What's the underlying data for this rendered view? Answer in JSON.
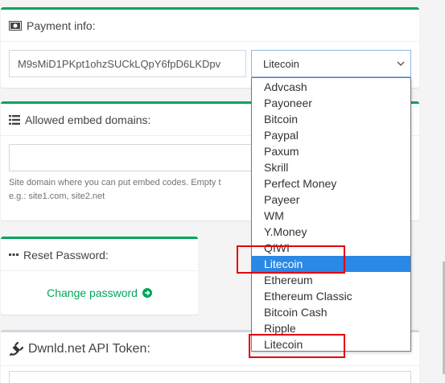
{
  "payment": {
    "title": "Payment info:",
    "address_value": "M9sMiD1PKpt1ohzSUCkLQpY6fpD6LKDpv",
    "method_selected": "Litecoin"
  },
  "dropdown": {
    "options": [
      "Advcash",
      "Payoneer",
      "Bitcoin",
      "Paypal",
      "Paxum",
      "Skrill",
      "Perfect Money",
      "Payeer",
      "WM",
      "Y.Money",
      "QIWI",
      "Litecoin",
      "Ethereum",
      "Ethereum Classic",
      "Bitcoin Cash",
      "Ripple",
      "Litecoin"
    ],
    "highlighted_index": 11
  },
  "embed": {
    "title": "Allowed embed domains:",
    "input_value": "",
    "help_line1": "Site domain where you can put embed codes. Empty t",
    "help_line2": "e.g.: site1.com, site2.net"
  },
  "reset": {
    "title": "Reset Password:",
    "link": "Change password"
  },
  "api": {
    "title": "Dwnld.net API Token:"
  },
  "colors": {
    "accent_green": "#00a65a",
    "highlight_blue": "#2a88e6",
    "annotation_red": "#e00000"
  },
  "icons": {
    "payment": "money-icon",
    "embed": "list-icon",
    "reset": "ellipsis-icon",
    "api": "plug-icon",
    "link_arrow": "arrow-circle-right-icon",
    "select": "chevron-down-icon"
  }
}
